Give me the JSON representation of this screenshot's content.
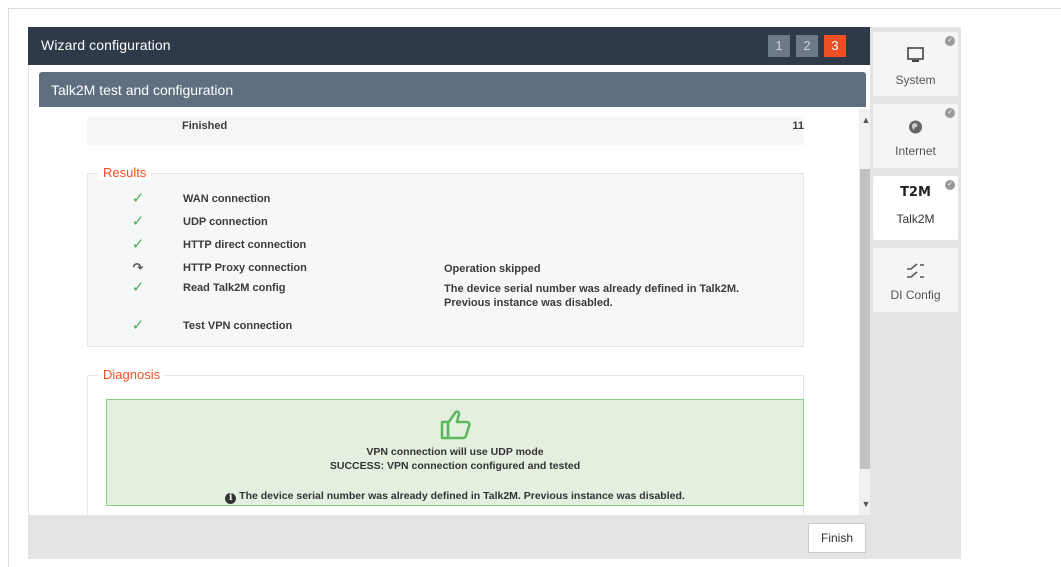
{
  "wizard": {
    "title": "Wizard configuration",
    "steps": [
      "1",
      "2",
      "3"
    ],
    "active_step": "3"
  },
  "section": {
    "title": "Talk2M test and configuration"
  },
  "summary": {
    "label": "Finished",
    "count": "11"
  },
  "results": {
    "legend": "Results",
    "items": [
      {
        "status": "ok",
        "name": "WAN connection",
        "message": ""
      },
      {
        "status": "ok",
        "name": "UDP connection",
        "message": ""
      },
      {
        "status": "ok",
        "name": "HTTP direct connection",
        "message": ""
      },
      {
        "status": "skipped",
        "name": "HTTP Proxy connection",
        "message": "Operation skipped"
      },
      {
        "status": "ok",
        "name": "Read Talk2M config",
        "message": "The device serial number was already defined in Talk2M.",
        "message2": "Previous instance was disabled."
      },
      {
        "status": "ok",
        "name": "Test VPN connection",
        "message": ""
      }
    ]
  },
  "diagnosis": {
    "legend": "Diagnosis",
    "icon": "thumbs-up-icon",
    "line1": "VPN connection will use UDP mode",
    "line2": "SUCCESS: VPN connection configured and tested",
    "note": "The device serial number was already defined in Talk2M. Previous instance was disabled."
  },
  "footer": {
    "finish_label": "Finish"
  },
  "side_nav": {
    "items": [
      {
        "label": "System",
        "icon": "monitor-icon"
      },
      {
        "label": "Internet",
        "icon": "globe-icon"
      },
      {
        "label": "Talk2M",
        "icon": "t2m-logo",
        "logo_text": "T2M"
      },
      {
        "label": "DI Config",
        "icon": "switch-icon"
      }
    ]
  },
  "colors": {
    "header_bg": "#2f3a48",
    "section_bg": "#5f6f80",
    "accent": "#f04e23",
    "success": "#4caf50",
    "success_bg": "#e3f0e0"
  }
}
